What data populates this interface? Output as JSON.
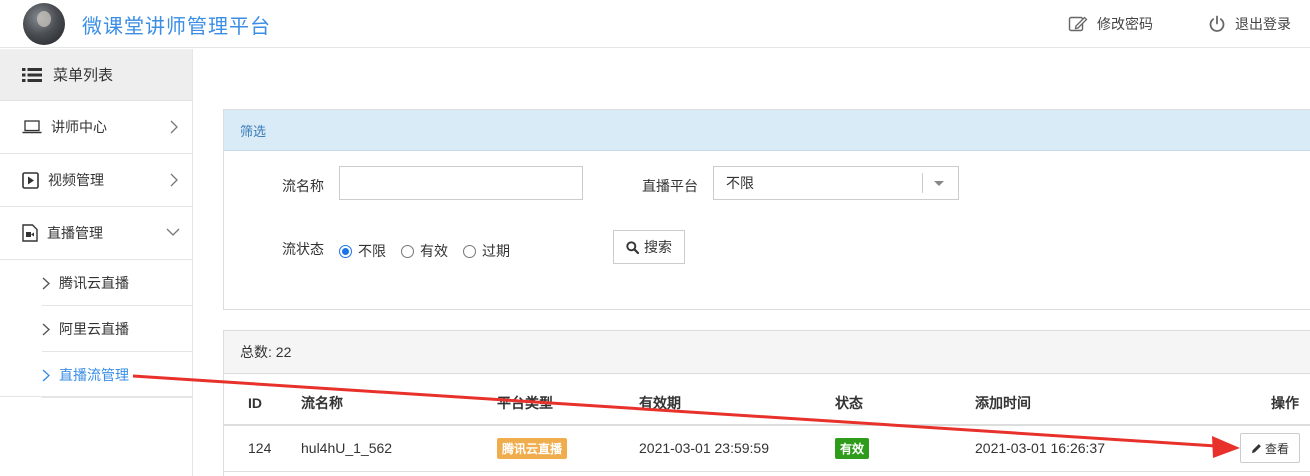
{
  "header": {
    "title": "微课堂讲师管理平台",
    "change_password": "修改密码",
    "logout": "退出登录"
  },
  "sidebar": {
    "menu_title": "菜单列表",
    "items": [
      {
        "label": "讲师中心",
        "icon": "laptop-icon",
        "expanded": false
      },
      {
        "label": "视频管理",
        "icon": "play-square-icon",
        "expanded": false
      },
      {
        "label": "直播管理",
        "icon": "camera-file-icon",
        "expanded": true
      }
    ],
    "sub_items": [
      {
        "label": "腾讯云直播",
        "active": false
      },
      {
        "label": "阿里云直播",
        "active": false
      },
      {
        "label": "直播流管理",
        "active": true
      }
    ]
  },
  "filter": {
    "heading": "筛选",
    "stream_name_label": "流名称",
    "stream_name_value": "",
    "platform_label": "直播平台",
    "platform_selected": "不限",
    "status_label": "流状态",
    "status_options": [
      "不限",
      "有效",
      "过期"
    ],
    "status_selected": "不限",
    "search_button": "搜索"
  },
  "list": {
    "total_label": "总数:",
    "total_count": "22",
    "columns": [
      "ID",
      "流名称",
      "平台类型",
      "有效期",
      "状态",
      "添加时间",
      "操作"
    ],
    "rows": [
      {
        "id": "124",
        "stream_name": "hul4hU_1_562",
        "platform": "腾讯云直播",
        "expiry": "2021-03-01 23:59:59",
        "status": "有效",
        "added_time": "2021-03-01 16:26:37",
        "action": "查看"
      }
    ]
  },
  "colors": {
    "brand": "#3a8ee6",
    "filter_header_bg": "#d9ebf7",
    "platform_badge": "#f0ad4e",
    "status_badge": "#2e9c1a",
    "annotation_arrow": "#e8312a"
  }
}
